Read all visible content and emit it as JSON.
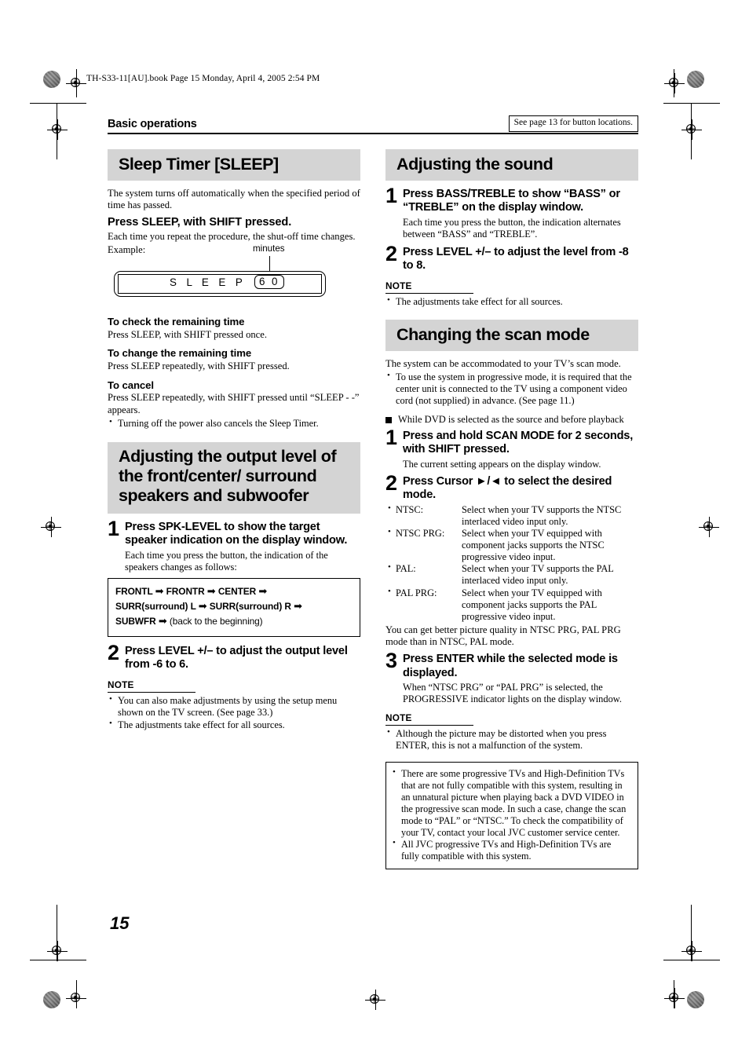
{
  "header": {
    "book_line": "TH-S33-11[AU].book  Page 15  Monday, April 4, 2005  2:54 PM",
    "section": "Basic operations",
    "see_also": "See page 13 for button locations.",
    "folio": "15"
  },
  "left_column": {
    "sleep": {
      "heading": "Sleep Timer [SLEEP]",
      "intro": "The system turns off automatically when the specified period of time has passed.",
      "action": "Press SLEEP, with SHIFT pressed.",
      "action_desc": "Each time you repeat the procedure, the shut-off time changes.",
      "example_label": "Example:",
      "display": {
        "minutes_label": "minutes",
        "text": "S L E E P",
        "value": "6 0"
      },
      "subsections": [
        {
          "title": "To check the remaining time",
          "body": "Press SLEEP, with SHIFT pressed once."
        },
        {
          "title": "To change the remaining time",
          "body": "Press SLEEP repeatedly, with SHIFT pressed."
        },
        {
          "title": "To cancel",
          "body": "Press SLEEP repeatedly, with SHIFT pressed until “SLEEP - -” appears."
        }
      ],
      "cancel_bullet": "Turning off the power also cancels the Sleep Timer."
    },
    "output_level": {
      "heading": "Adjusting the output level of the front/center/ surround speakers and subwoofer",
      "steps": [
        {
          "num": "1",
          "title": "Press SPK-LEVEL to show the target speaker indication on the display window.",
          "desc": "Each time you press the button, the indication of the speakers changes as follows:"
        },
        {
          "num": "2",
          "title": "Press LEVEL +/– to adjust the output level from -6 to 6.",
          "desc": ""
        }
      ],
      "sequence": {
        "line1_a": "FRONTL",
        "line1_b": "FRONTR",
        "line1_c": "CENTER",
        "line2_a": "SURR(surround) L",
        "line2_b": "SURR(surround) R",
        "line3_a": "SUBWFR",
        "line3_b": "(back to the beginning)",
        "arrow": "➡"
      },
      "note_title": "NOTE",
      "notes": [
        "You can also make adjustments by using the setup menu shown on the TV screen. (See page 33.)",
        "The adjustments take effect for all sources."
      ]
    }
  },
  "right_column": {
    "sound": {
      "heading": "Adjusting the sound",
      "steps": [
        {
          "num": "1",
          "title": "Press BASS/TREBLE to show “BASS” or “TREBLE” on the display window.",
          "desc": "Each time you press the button, the indication alternates between “BASS” and “TREBLE”."
        },
        {
          "num": "2",
          "title": "Press LEVEL +/– to adjust the level from -8 to 8.",
          "desc": ""
        }
      ],
      "note_title": "NOTE",
      "notes": [
        "The adjustments take effect for all sources."
      ]
    },
    "scan": {
      "heading": "Changing the scan mode",
      "intro": "The system can be accommodated to your TV’s scan mode.",
      "intro_bullets": [
        "To use the system in progressive mode, it is required that the center unit is connected to the TV using a component video cord (not supplied) in advance. (See page 11.)"
      ],
      "square_head": "While DVD is selected as the source and before playback",
      "steps": [
        {
          "num": "1",
          "title": "Press and hold SCAN MODE for 2 seconds, with SHIFT pressed.",
          "desc": "The current setting appears on the display window."
        },
        {
          "num": "2",
          "title": "Press Cursor ►/◄ to select the desired mode.",
          "desc": ""
        },
        {
          "num": "3",
          "title": "Press ENTER while the selected mode is displayed.",
          "desc": "When “NTSC PRG” or “PAL PRG” is selected, the PROGRESSIVE indicator lights on the display window."
        }
      ],
      "modes": [
        {
          "term": "NTSC:",
          "def": "Select when your TV supports the NTSC interlaced video input only."
        },
        {
          "term": "NTSC PRG:",
          "def": "Select when your TV equipped with component jacks supports the NTSC progressive video input."
        },
        {
          "term": "PAL:",
          "def": "Select when your TV supports the PAL interlaced video input only."
        },
        {
          "term": "PAL PRG:",
          "def": "Select when your TV equipped with component jacks supports the PAL progressive video input."
        }
      ],
      "modes_footer": "You can get better picture quality in NTSC PRG, PAL PRG mode than in NTSC, PAL mode.",
      "note_title": "NOTE",
      "notes": [
        "Although the picture may be distorted when you press ENTER, this is not a malfunction of the system."
      ],
      "warning_box": [
        "There are some progressive TVs and High-Definition TVs that are not fully compatible with this system, resulting in an unnatural picture when playing back a DVD VIDEO in the progressive scan mode. In such a case, change the scan mode to “PAL” or “NTSC.” To check the compatibility of your TV, contact your local JVC customer service center.",
        "All JVC progressive TVs and High-Definition TVs are fully compatible with this system."
      ]
    }
  }
}
